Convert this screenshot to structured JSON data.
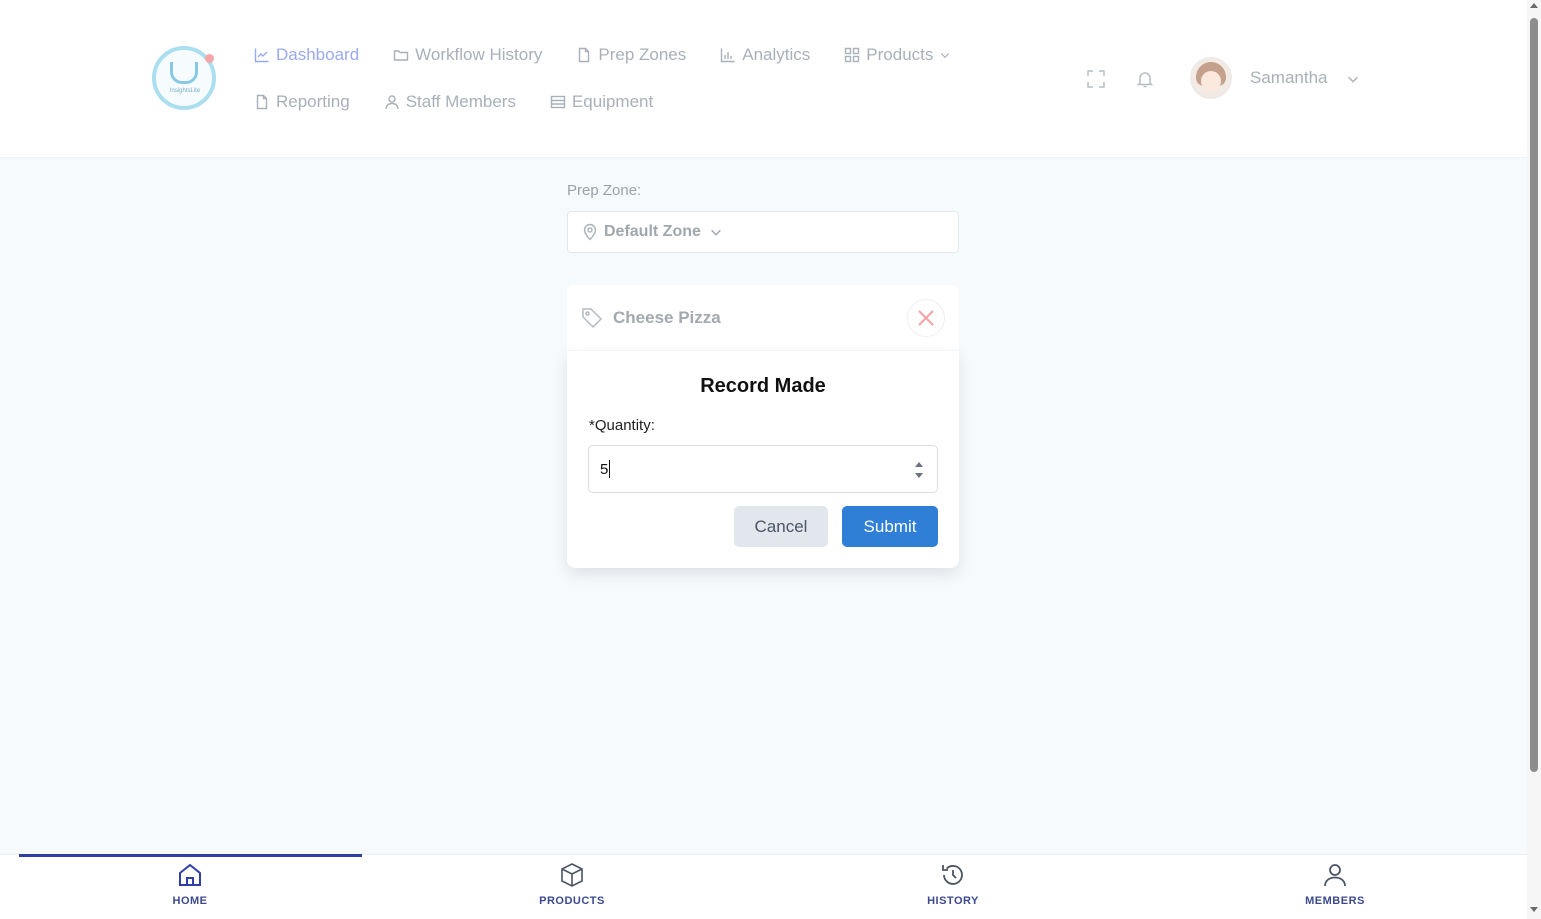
{
  "header": {
    "logo_text": "InsightsLite",
    "nav_row1": [
      {
        "label": "Dashboard",
        "icon": "line-chart-icon",
        "active": true
      },
      {
        "label": "Workflow History",
        "icon": "folder-icon"
      },
      {
        "label": "Prep Zones",
        "icon": "document-icon"
      },
      {
        "label": "Analytics",
        "icon": "bar-chart-icon"
      },
      {
        "label": "Products",
        "icon": "grid-icon",
        "dropdown": true
      }
    ],
    "nav_row2": [
      {
        "label": "Reporting",
        "icon": "document-icon"
      },
      {
        "label": "Staff Members",
        "icon": "user-icon"
      },
      {
        "label": "Equipment",
        "icon": "list-icon"
      }
    ],
    "user": {
      "name": "Samantha"
    }
  },
  "main": {
    "prep_zone_label": "Prep Zone:",
    "prep_zone_value": "Default Zone",
    "product_name": "Cheese Pizza"
  },
  "modal": {
    "title": "Record Made",
    "quantity_label": "*Quantity:",
    "quantity_value": "5",
    "cancel_label": "Cancel",
    "submit_label": "Submit"
  },
  "bottom_nav": [
    {
      "label": "HOME",
      "icon": "home-icon",
      "active": true
    },
    {
      "label": "PRODUCTS",
      "icon": "box-icon"
    },
    {
      "label": "HISTORY",
      "icon": "history-icon"
    },
    {
      "label": "MEMBERS",
      "icon": "user-icon"
    }
  ],
  "colors": {
    "accent": "#2f7fd6",
    "nav_active": "#9aaaf0",
    "bottom_nav_text": "#3c4a8c",
    "close_icon": "#f3a3a3"
  }
}
